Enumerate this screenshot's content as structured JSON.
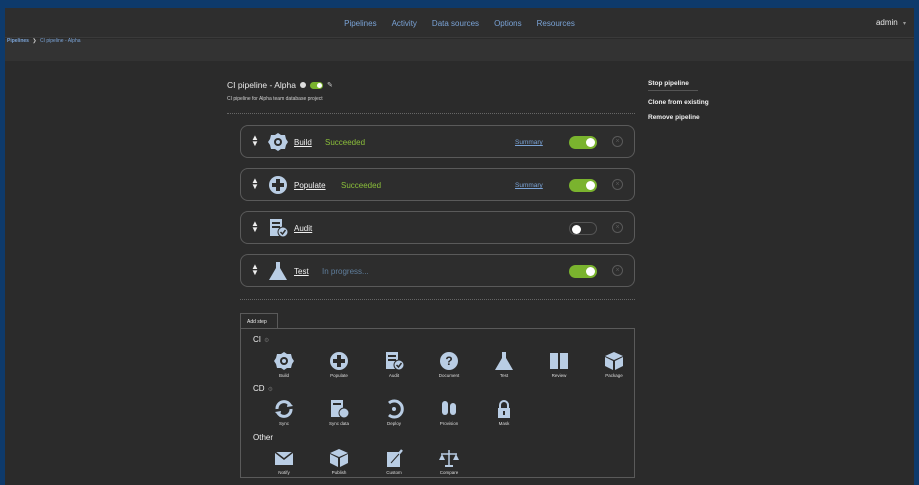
{
  "nav": {
    "links": [
      "Pipelines",
      "Activity",
      "Data sources",
      "Options",
      "Resources"
    ],
    "user": "admin",
    "user_caret": "▾"
  },
  "breadcrumb": {
    "root": "Pipelines",
    "sep": "❯",
    "current": "CI pipeline - Alpha"
  },
  "pipeline": {
    "title": "CI pipeline - Alpha",
    "description": "CI pipeline for Alpha team database project"
  },
  "actions": {
    "stop": "Stop pipeline",
    "clone": "Clone from existing",
    "remove": "Remove pipeline"
  },
  "steps": [
    {
      "name": "Build",
      "status": "Succeeded",
      "summary": "Summary",
      "enabled": "on",
      "icon": "gear-icon"
    },
    {
      "name": "Populate",
      "status": "Succeeded",
      "summary": "Summary",
      "enabled": "on",
      "icon": "plus-circle-icon"
    },
    {
      "name": "Audit",
      "status": "",
      "summary": "",
      "enabled": "off",
      "icon": "audit-doc-icon"
    },
    {
      "name": "Test",
      "status": "In progress...",
      "summary": "",
      "enabled": "on",
      "icon": "flask-icon"
    }
  ],
  "add_step": {
    "tab": "Add step",
    "groups": [
      {
        "label": "CI",
        "items": [
          "Build",
          "Populate",
          "Audit",
          "Document",
          "Test",
          "Review",
          "Package"
        ]
      },
      {
        "label": "CD",
        "items": [
          "Sync",
          "Sync data",
          "Deploy",
          "Provision",
          "Mask"
        ]
      },
      {
        "label": "Other",
        "items": [
          "Notify",
          "Publish",
          "Custom",
          "Compare"
        ]
      }
    ]
  },
  "colors": {
    "accent": "#7aa3d6",
    "success": "#8bbf3a",
    "toggle_on": "#7ab32e",
    "icon": "#b9cde4"
  }
}
